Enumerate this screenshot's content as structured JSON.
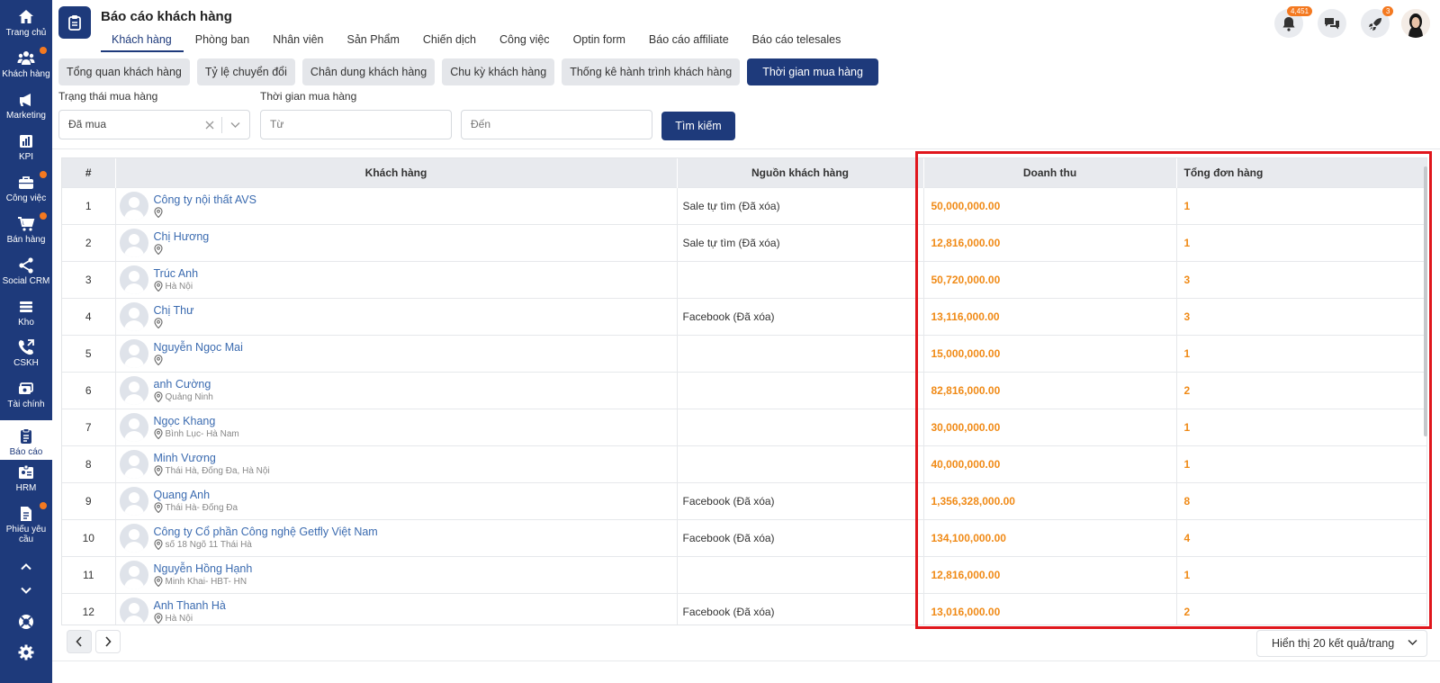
{
  "sidebar": {
    "items": [
      {
        "label": "Trang chủ",
        "icon": "home-icon",
        "dot": false
      },
      {
        "label": "Khách hàng",
        "icon": "users-icon",
        "dot": true
      },
      {
        "label": "Marketing",
        "icon": "megaphone-icon",
        "dot": false
      },
      {
        "label": "KPI",
        "icon": "chart-icon",
        "dot": false
      },
      {
        "label": "Công việc",
        "icon": "briefcase-icon",
        "dot": true
      },
      {
        "label": "Bán hàng",
        "icon": "cart-icon",
        "dot": true
      },
      {
        "label": "Social CRM",
        "icon": "share-icon",
        "dot": false
      },
      {
        "label": "Kho",
        "icon": "warehouse-icon",
        "dot": false
      },
      {
        "label": "CSKH",
        "icon": "phone-icon",
        "dot": false
      },
      {
        "label": "Tài chính",
        "icon": "money-icon",
        "dot": false
      },
      {
        "label": "Báo cáo",
        "icon": "clipboard-icon",
        "dot": false,
        "active": true
      },
      {
        "label": "HRM",
        "icon": "id-card-icon",
        "dot": false
      },
      {
        "label": "Phiếu yêu cầu",
        "icon": "document-icon",
        "dot": true
      }
    ]
  },
  "header": {
    "title": "Báo cáo khách hàng",
    "tabs": [
      "Khách hàng",
      "Phòng ban",
      "Nhân viên",
      "Sản Phẩm",
      "Chiến dịch",
      "Công việc",
      "Optin form",
      "Báo cáo affiliate",
      "Báo cáo telesales"
    ],
    "notification_count": "4,451",
    "rocket_count": "3"
  },
  "subtabs": [
    "Tổng quan khách hàng",
    "Tỷ lệ chuyển đổi",
    "Chân dung khách hàng",
    "Chu kỳ khách hàng",
    "Thống kê hành trình khách hàng",
    "Thời gian mua hàng"
  ],
  "filters": {
    "status_label": "Trạng thái mua hàng",
    "status_value": "Đã mua",
    "time_label": "Thời gian mua hàng",
    "from_placeholder": "Từ",
    "to_placeholder": "Đến",
    "search_button": "Tìm kiếm"
  },
  "table": {
    "headers": [
      "#",
      "Khách hàng",
      "Nguồn khách hàng",
      "Doanh thu",
      "Tổng đơn hàng"
    ],
    "rows": [
      {
        "no": "1",
        "name": "Công ty nội thất AVS",
        "address": "",
        "source": "Sale tự tìm (Đã xóa)",
        "revenue": "50,000,000.00",
        "orders": "1"
      },
      {
        "no": "2",
        "name": "Chị Hương",
        "address": "",
        "source": "Sale tự tìm (Đã xóa)",
        "revenue": "12,816,000.00",
        "orders": "1"
      },
      {
        "no": "3",
        "name": "Trúc Anh",
        "address": "Hà Nội",
        "source": "",
        "revenue": "50,720,000.00",
        "orders": "3"
      },
      {
        "no": "4",
        "name": "Chị Thư",
        "address": "",
        "source": "Facebook (Đã xóa)",
        "revenue": "13,116,000.00",
        "orders": "3"
      },
      {
        "no": "5",
        "name": "Nguyễn Ngọc Mai",
        "address": "",
        "source": "",
        "revenue": "15,000,000.00",
        "orders": "1"
      },
      {
        "no": "6",
        "name": "anh Cường",
        "address": "Quảng Ninh",
        "source": "",
        "revenue": "82,816,000.00",
        "orders": "2"
      },
      {
        "no": "7",
        "name": "Ngọc Khang",
        "address": "Bình Lục- Hà Nam",
        "source": "",
        "revenue": "30,000,000.00",
        "orders": "1"
      },
      {
        "no": "8",
        "name": "Minh Vương",
        "address": "Thái Hà, Đống Đa, Hà Nội",
        "source": "",
        "revenue": "40,000,000.00",
        "orders": "1"
      },
      {
        "no": "9",
        "name": "Quang Anh",
        "address": "Thái Hà- Đống Đa",
        "source": "Facebook (Đã xóa)",
        "revenue": "1,356,328,000.00",
        "orders": "8"
      },
      {
        "no": "10",
        "name": "Công ty Cổ phần Công nghệ Getfly Việt Nam",
        "address": "số 18 Ngõ 11 Thái Hà",
        "source": "Facebook (Đã xóa)",
        "revenue": "134,100,000.00",
        "orders": "4"
      },
      {
        "no": "11",
        "name": "Nguyễn Hồng Hạnh",
        "address": "Minh Khai- HBT- HN",
        "source": "",
        "revenue": "12,816,000.00",
        "orders": "1"
      },
      {
        "no": "12",
        "name": "Anh Thanh Hà",
        "address": "Hà Nội",
        "source": "Facebook (Đã xóa)",
        "revenue": "13,016,000.00",
        "orders": "2"
      }
    ]
  },
  "footer": {
    "per_page": "Hiển thị 20 kết quả/trang"
  },
  "colors": {
    "primary": "#1e3a7b",
    "accent": "#f47920",
    "value": "#f08a16",
    "highlight": "#e0161c"
  }
}
